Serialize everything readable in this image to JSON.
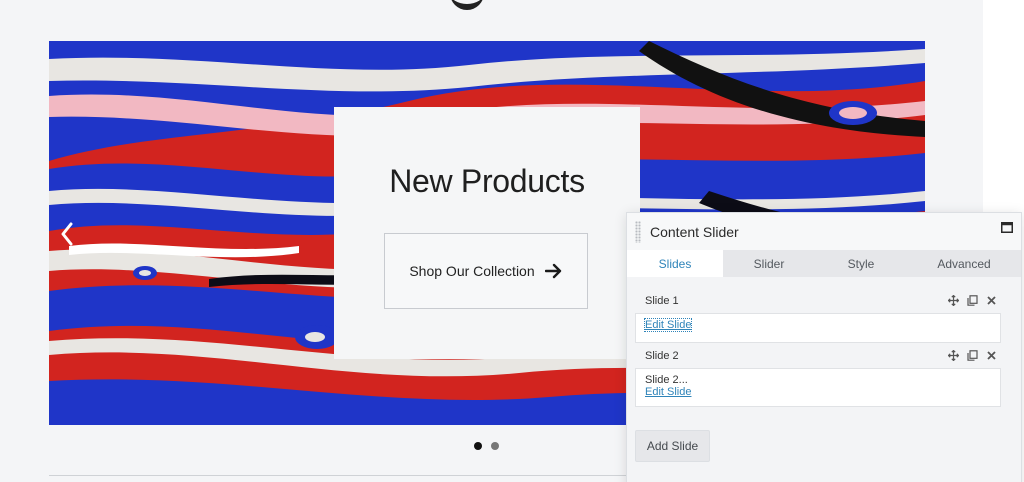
{
  "slider": {
    "title": "New Products",
    "cta_label": "Shop Our Collection",
    "active_dot": 1,
    "dot_count": 2
  },
  "panel": {
    "title": "Content Slider",
    "tabs": [
      {
        "label": "Slides",
        "active": true
      },
      {
        "label": "Slider",
        "active": false
      },
      {
        "label": "Style",
        "active": false
      },
      {
        "label": "Advanced",
        "active": false
      }
    ],
    "slides": [
      {
        "label": "Slide 1",
        "preview": "",
        "edit_label": "Edit Slide"
      },
      {
        "label": "Slide 2",
        "preview": "Slide 2...",
        "edit_label": "Edit Slide"
      }
    ],
    "add_slide_label": "Add Slide"
  },
  "colors": {
    "accent": "#2f84b9",
    "art_red": "#d2241f",
    "art_blue": "#1f35c8",
    "art_white": "#e8e6e2"
  },
  "icons": {
    "prev": "chevron-left-icon",
    "cta": "arrow-right-icon",
    "maximize": "window-maximize-icon",
    "move": "move-icon",
    "copy": "copy-icon",
    "remove": "close-icon"
  }
}
